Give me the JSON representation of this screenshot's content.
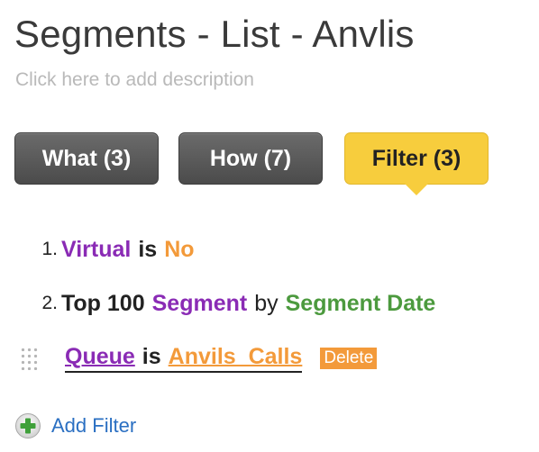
{
  "header": {
    "title": "Segments - List - Anvlis",
    "description_placeholder": "Click here to add description"
  },
  "tabs": [
    {
      "label": "What (3)",
      "active": false
    },
    {
      "label": "How (7)",
      "active": false
    },
    {
      "label": "Filter (3)",
      "active": true
    }
  ],
  "filters": [
    {
      "number": "1.",
      "field": "Virtual",
      "operator": "is",
      "value": "No"
    },
    {
      "number": "2.",
      "prefix": "Top 100",
      "field": "Segment",
      "connector": "by",
      "value": "Segment Date"
    },
    {
      "field": "Queue",
      "operator": "is",
      "value": "Anvils_Calls",
      "delete_label": "Delete"
    }
  ],
  "add_filter": {
    "label": "Add Filter",
    "icon": "plus-circle-icon"
  },
  "colors": {
    "tab_dark": "#565656",
    "tab_active": "#f7cd3d",
    "field": "#8a2bb5",
    "value": "#f39a3a",
    "date": "#4c9a3e",
    "link": "#2a6fc2"
  }
}
